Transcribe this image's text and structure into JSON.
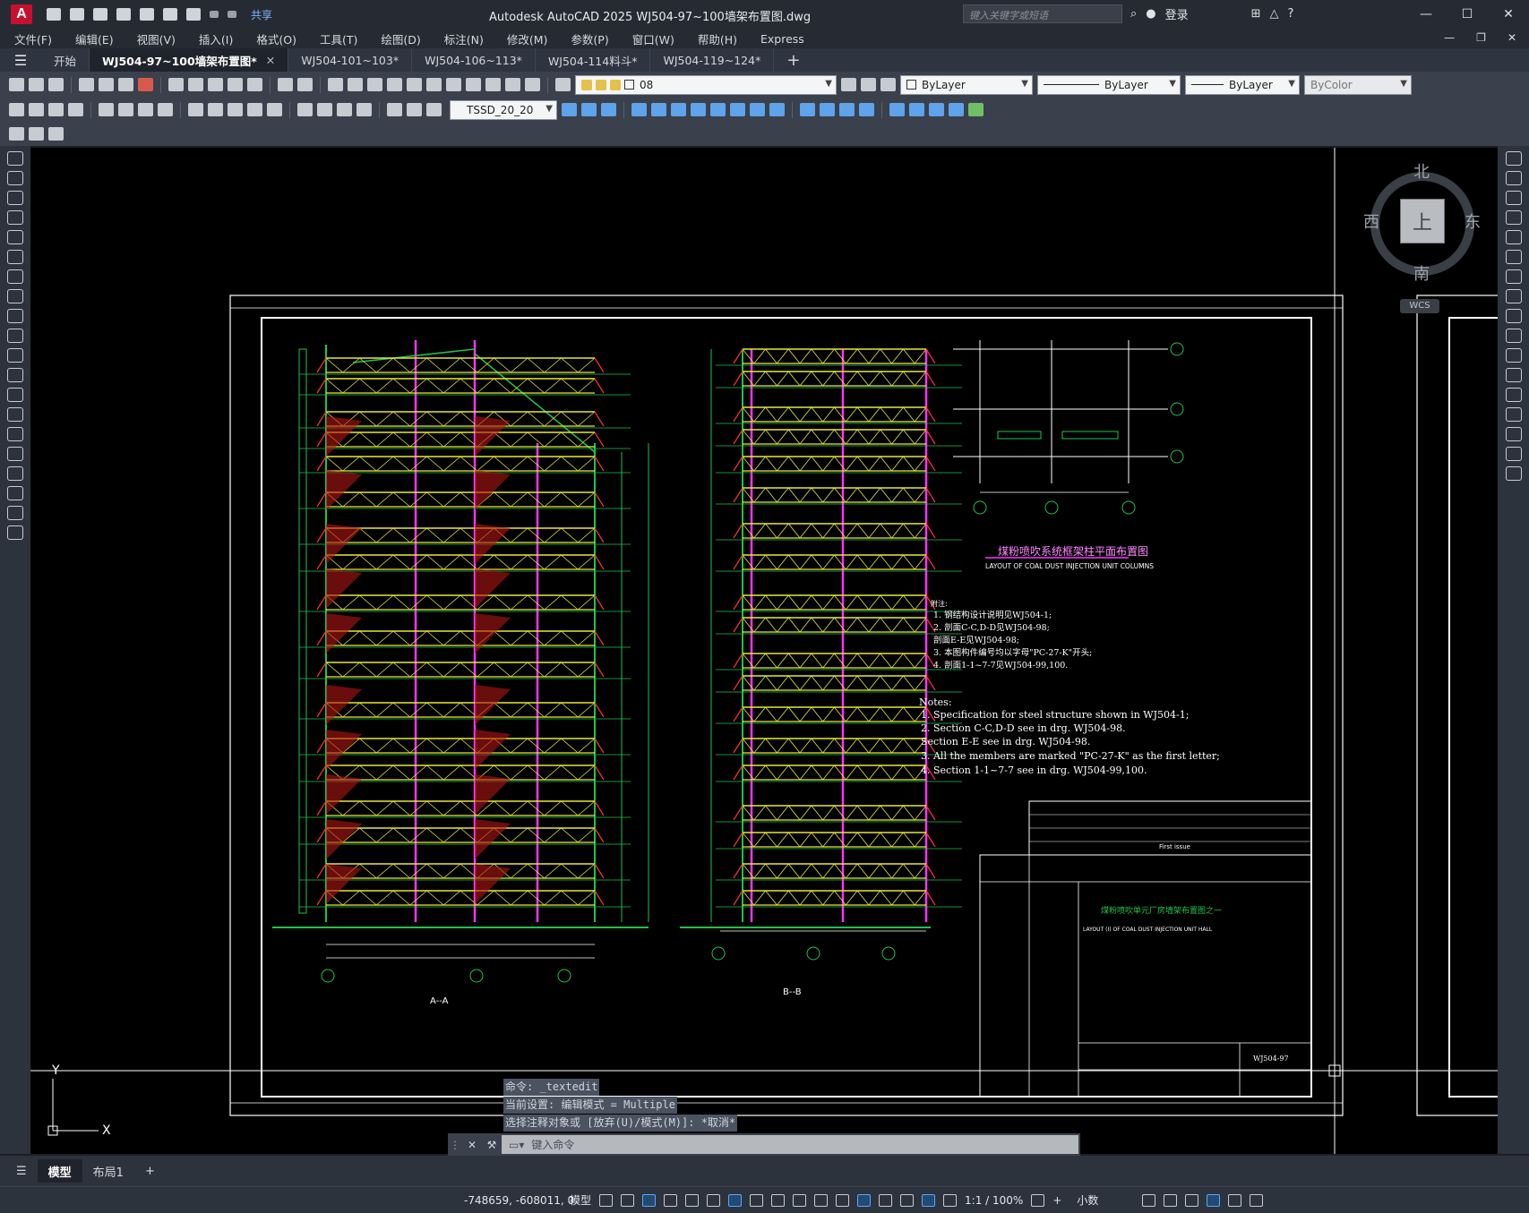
{
  "titlebar": {
    "logo": "A",
    "share": "共享",
    "title": "Autodesk AutoCAD 2025    WJ504-97~100墙架布置图.dwg",
    "search_placeholder": "键入关键字或短语",
    "login": "登录"
  },
  "menu": [
    "文件(F)",
    "编辑(E)",
    "视图(V)",
    "插入(I)",
    "格式(O)",
    "工具(T)",
    "绘图(D)",
    "标注(N)",
    "修改(M)",
    "参数(P)",
    "窗口(W)",
    "帮助(H)",
    "Express"
  ],
  "tabs": [
    {
      "label": "开始"
    },
    {
      "label": "WJ504-97~100墙架布置图*",
      "active": true
    },
    {
      "label": "WJ504-101~103*"
    },
    {
      "label": "WJ504-106~113*"
    },
    {
      "label": "WJ504-114料斗*"
    },
    {
      "label": "WJ504-119~124*"
    }
  ],
  "toolbar": {
    "layer_value": "08",
    "color": "ByLayer",
    "linetype": "ByLayer",
    "lineweight": "ByLayer",
    "plotstyle": "ByColor",
    "textstyle": "TSSD_20_20"
  },
  "viewcube": {
    "north": "北",
    "south": "南",
    "east": "东",
    "west": "西",
    "top": "上",
    "wcs": "WCS"
  },
  "drawing": {
    "plan_title_cn": "煤粉喷吹系统框架柱平面布置图",
    "plan_title_en": "LAYOUT OF COAL DUST INJECTION UNIT COLUMNS",
    "notes_cn_head": "附注:",
    "notes_cn": [
      "1. 钢结构设计说明见WJ504-1;",
      "2. 剖面C-C,D-D见WJ504-98;",
      "   剖面E-E见WJ504-98;",
      "3. 本图构件编号均以字母\"PC-27-K\"开头;",
      "4. 剖面1-1~7-7见WJ504-99,100."
    ],
    "notes_en_head": "Notes:",
    "notes_en": [
      "1. Specification for steel structure shown in WJ504-1;",
      "2. Section C-C,D-D see in drg. WJ504-98.",
      "   Section E-E see in drg. WJ504-98.",
      "3. All the members are marked \"PC-27-K\" as the first letter;",
      "4. Section 1-1~7-7 see in drg. WJ504-99,100."
    ],
    "section_a": "A--A",
    "section_b": "B--B",
    "tb_title_cn": "煤粉喷吹单元厂房墙架布置图之一",
    "tb_title_en": "LAYOUT (I) OF COAL DUST INJECTION UNIT HALL",
    "tb_drawing_no": "WJ504-97",
    "tb_first_issue": "First issue"
  },
  "command": {
    "history": [
      "命令: _textedit",
      "当前设置: 编辑模式 = Multiple",
      "选择注释对象或 [放弃(U)/模式(M)]: *取消*"
    ],
    "placeholder": "键入命令"
  },
  "layouts": [
    "模型",
    "布局1"
  ],
  "status": {
    "coords": "-748659, -608011, 0",
    "model": "模型",
    "scale": "1:1 / 100%",
    "units": "小数"
  }
}
